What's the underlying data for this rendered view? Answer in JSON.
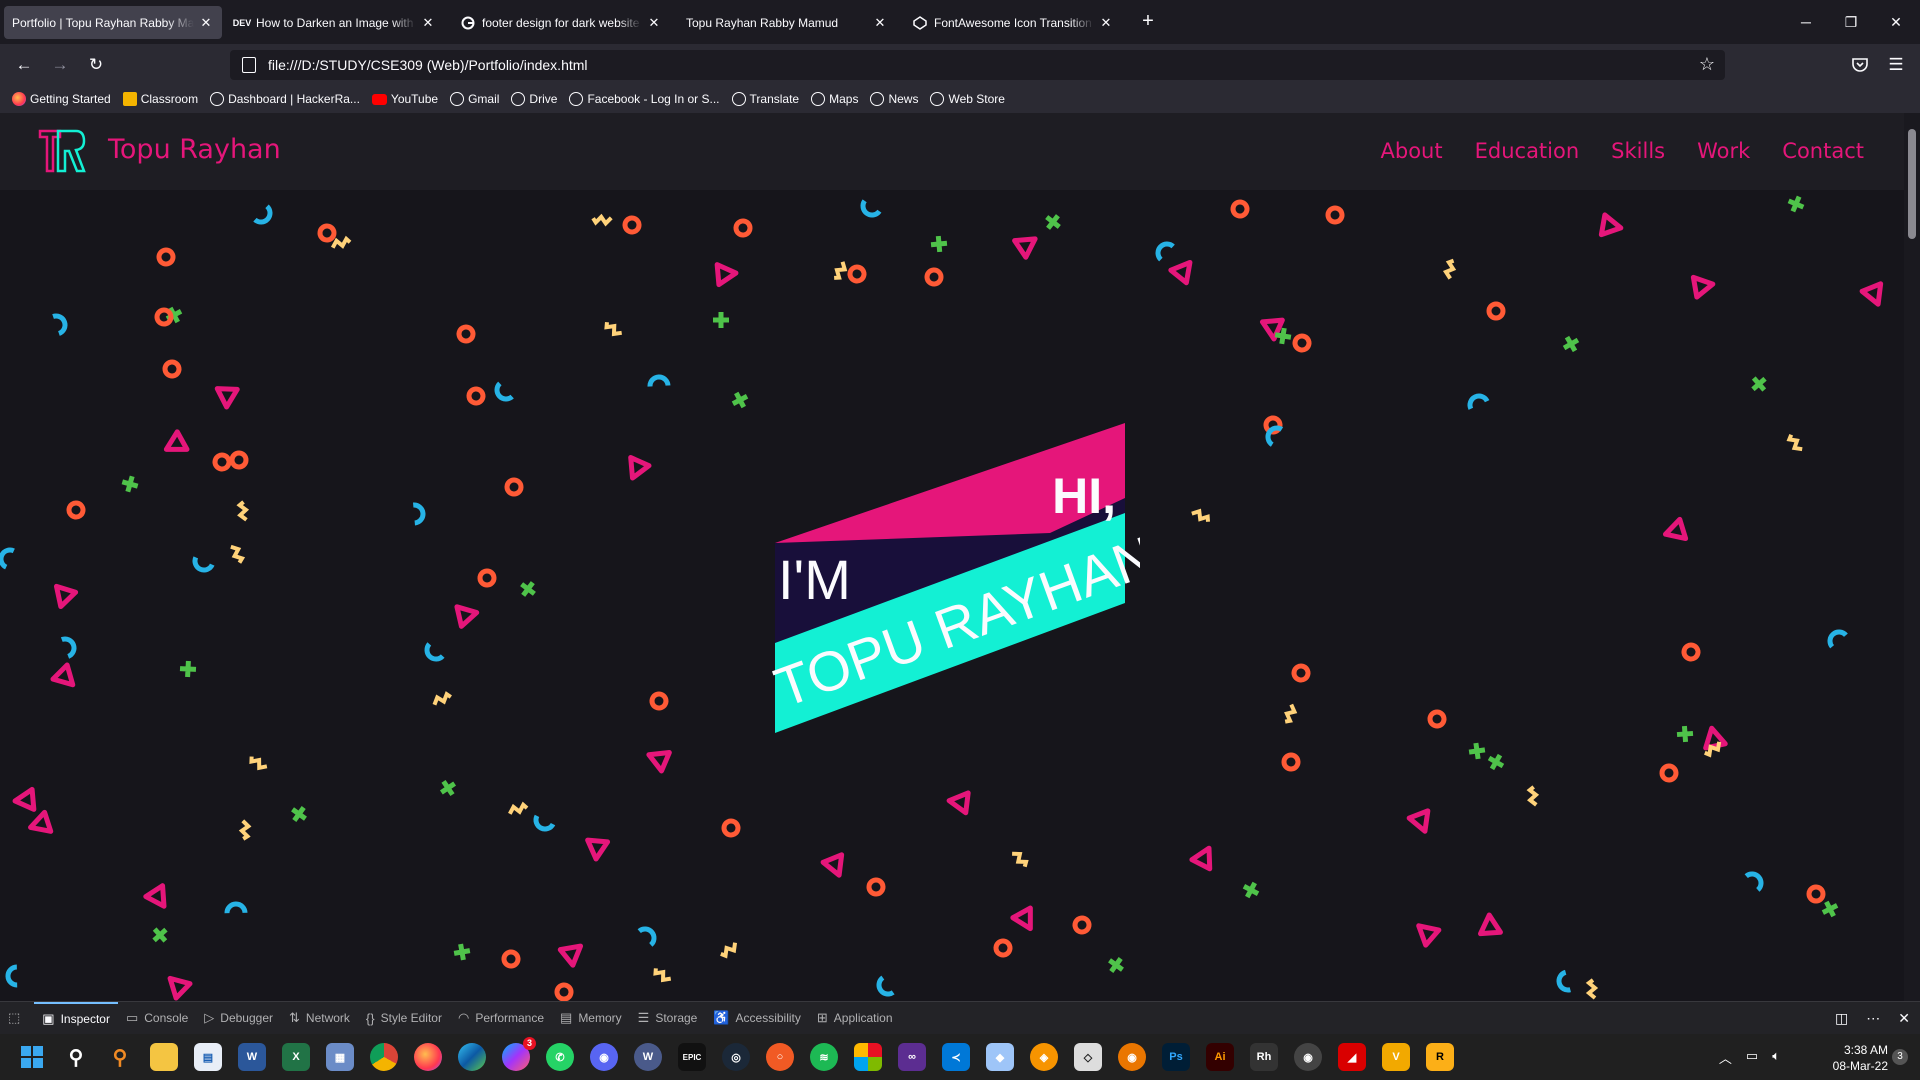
{
  "browser": {
    "tabs": [
      {
        "label": "Portfolio | Topu Rayhan Rabby Mamud",
        "favicon": "blank",
        "active": true
      },
      {
        "label": "How to Darken an Image with CSS",
        "favicon": "DEV",
        "active": false
      },
      {
        "label": "footer design for dark website - Google Search",
        "favicon": "google",
        "active": false
      },
      {
        "label": "Topu Rayhan Rabby Mamud",
        "favicon": "blank",
        "active": false
      },
      {
        "label": "FontAwesome Icon Transition Hover Effect",
        "favicon": "codepen",
        "active": false
      }
    ],
    "url": "file:///D:/STUDY/CSE309 (Web)/Portfolio/index.html",
    "bookmarks": [
      {
        "label": "Getting Started",
        "icon": "firefox-icon"
      },
      {
        "label": "Classroom",
        "icon": "classroom-icon"
      },
      {
        "label": "Dashboard | HackerRa...",
        "icon": "globe-icon"
      },
      {
        "label": "YouTube",
        "icon": "youtube-icon"
      },
      {
        "label": "Gmail",
        "icon": "globe-icon"
      },
      {
        "label": "Drive",
        "icon": "globe-icon"
      },
      {
        "label": "Facebook - Log In or S...",
        "icon": "globe-icon"
      },
      {
        "label": "Translate",
        "icon": "globe-icon"
      },
      {
        "label": "Maps",
        "icon": "globe-icon"
      },
      {
        "label": "News",
        "icon": "globe-icon"
      },
      {
        "label": "Web Store",
        "icon": "globe-icon"
      }
    ]
  },
  "site": {
    "brand": "Topu Rayhan",
    "nav": [
      "About",
      "Education",
      "Skills",
      "Work",
      "Contact"
    ],
    "hero": {
      "line1": "HI,",
      "line2": "I'M",
      "line3": "TOPU RAYHAN"
    },
    "colors": {
      "pink": "#e5167a",
      "cyan": "#13f0d4",
      "navy": "#180f3a",
      "bg": "#16151b"
    }
  },
  "devtools": {
    "tabs": [
      "Inspector",
      "Console",
      "Debugger",
      "Network",
      "Style Editor",
      "Performance",
      "Memory",
      "Storage",
      "Accessibility",
      "Application"
    ],
    "active": "Inspector"
  },
  "taskbar": {
    "time": "3:38 AM",
    "date": "08-Mar-22",
    "notifications": "3",
    "messenger_badge": "3"
  }
}
